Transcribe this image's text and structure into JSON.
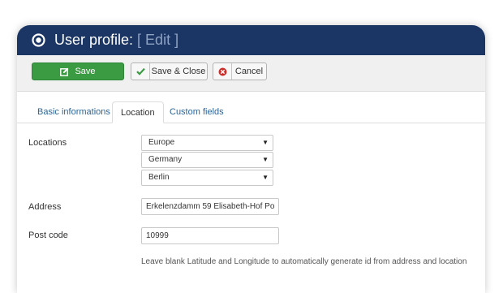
{
  "title": {
    "main": "User profile:",
    "edit": "[ Edit ]"
  },
  "toolbar": {
    "save_label": "Save",
    "save_close_label": "Save & Close",
    "cancel_label": "Cancel"
  },
  "tabs": [
    {
      "label": "Basic informations",
      "active": false
    },
    {
      "label": "Location",
      "active": true
    },
    {
      "label": "Custom fields",
      "active": false
    }
  ],
  "form": {
    "locations_label": "Locations",
    "continent": "Europe",
    "country": "Germany",
    "city": "Berlin",
    "address_label": "Address",
    "address_value": "Erkelenzdamm 59 Elisabeth-Hof Po",
    "postcode_label": "Post code",
    "postcode_value": "10999",
    "help_text": "Leave blank Latitude and Longitude to automatically generate id from address and location"
  },
  "colors": {
    "titlebar": "#1b3664",
    "save_button": "#3a9b43",
    "tab_link": "#2a6496",
    "cancel_icon": "#c9302c"
  }
}
